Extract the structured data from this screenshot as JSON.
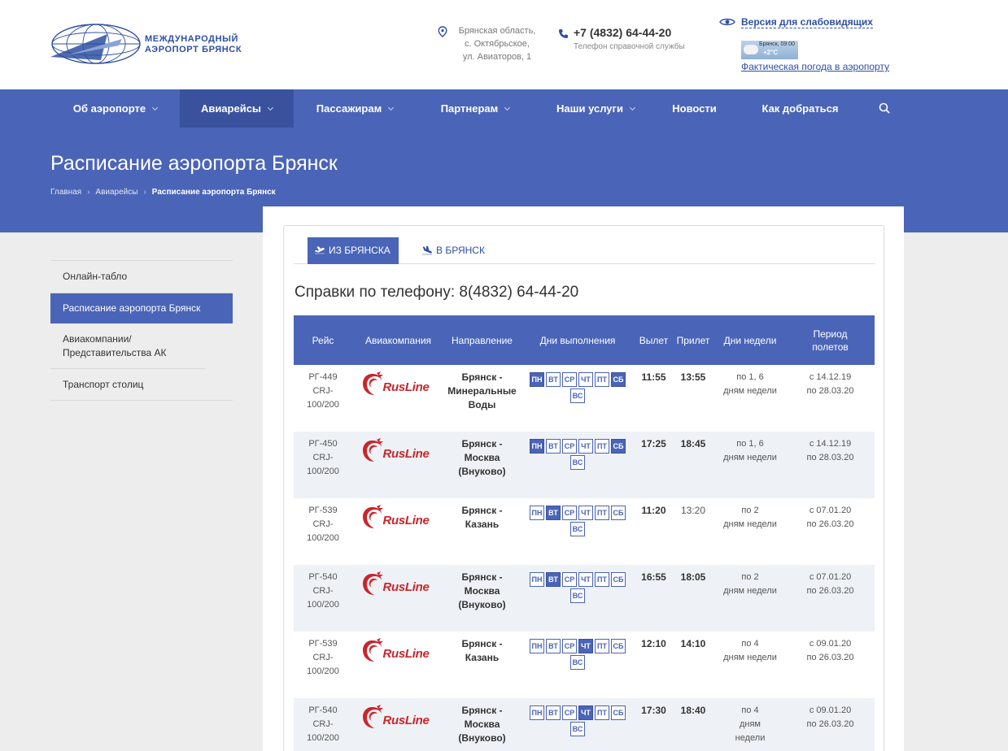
{
  "header": {
    "logo_line1": "МЕЖДУНАРОДНЫЙ",
    "logo_line2": "АЭРОПОРТ БРЯНСК",
    "address_lines": [
      "Брянская область,",
      "с. Октябрьское,",
      "ул. Авиаторов, 1"
    ],
    "phone": "+7 (4832) 64-44-20",
    "phone_label": "Телефон справочной службы",
    "vision_link": "Версия для слабовидящих",
    "weather_place": "Брянск, 09:00",
    "weather_temp": "+2°C",
    "weather_link": "Фактическая погода в аэропорту"
  },
  "nav": {
    "items": [
      {
        "label": "Об аэропорте",
        "dropdown": true
      },
      {
        "label": "Авиарейсы",
        "dropdown": true,
        "active": true
      },
      {
        "label": "Пассажирам",
        "dropdown": true
      },
      {
        "label": "Партнерам",
        "dropdown": true
      },
      {
        "label": "Наши услуги",
        "dropdown": true
      },
      {
        "label": "Новости",
        "dropdown": false
      },
      {
        "label": "Как добраться",
        "dropdown": false
      }
    ],
    "search_icon": "search-icon"
  },
  "banner": {
    "title": "Расписание аэропорта Брянск",
    "breadcrumb": [
      "Главная",
      "Авиарейсы",
      "Расписание аэропорта Брянск"
    ]
  },
  "sidebar": {
    "items": [
      {
        "label": "Онлайн-табло"
      },
      {
        "label": "Расписание аэропорта Брянск",
        "active": true
      },
      {
        "label": "Авиакомпании/ Представительства АК"
      },
      {
        "label": "Транспорт столиц"
      }
    ]
  },
  "tabs": {
    "from": "ИЗ БРЯНСКА",
    "to": "В БРЯНСК"
  },
  "phone_heading": "Справки по телефону: 8(4832) 64-44-20",
  "table": {
    "headers": {
      "flight": "Рейс",
      "airline": "Авиакомпания",
      "direction": "Направление",
      "days": "Дни выполнения",
      "departure": "Вылет",
      "arrival": "Прилет",
      "weekdays": "Дни недели",
      "period_line1": "Период",
      "period_line2": "полетов"
    },
    "day_labels": [
      "ПН",
      "ВТ",
      "СР",
      "ЧТ",
      "ПТ",
      "СБ",
      "ВС"
    ],
    "airline_name": "RusLine",
    "rows": [
      {
        "flight": [
          "РГ-449",
          "CRJ-",
          "100/200"
        ],
        "direction": [
          "Брянск -",
          "Минеральные",
          "Воды"
        ],
        "days_on": [
          1,
          6
        ],
        "dep": "11:55",
        "arr": "13:55",
        "arr_light": false,
        "weekdays": [
          "по 1, 6",
          "дням недели"
        ],
        "period": [
          "с 14.12.19",
          "по 28.03.20"
        ]
      },
      {
        "flight": [
          "РГ-450",
          "CRJ-",
          "100/200"
        ],
        "direction": [
          "Брянск -",
          "Москва",
          "(Внуково)"
        ],
        "days_on": [
          1,
          6
        ],
        "dep": "17:25",
        "arr": "18:45",
        "arr_light": false,
        "weekdays": [
          "по 1, 6",
          "дням недели"
        ],
        "period": [
          "с 14.12.19",
          "по 28.03.20"
        ]
      },
      {
        "flight": [
          "РГ-539",
          "CRJ-",
          "100/200"
        ],
        "direction": [
          "Брянск -",
          "Казань"
        ],
        "days_on": [
          2
        ],
        "dep": "11:20",
        "arr": "13:20",
        "arr_light": true,
        "weekdays": [
          "по 2",
          "дням недели"
        ],
        "period": [
          "с 07.01.20",
          "по 26.03.20"
        ]
      },
      {
        "flight": [
          "РГ-540",
          "CRJ-",
          "100/200"
        ],
        "direction": [
          "Брянск -",
          "Москва",
          "(Внуково)"
        ],
        "days_on": [
          2
        ],
        "dep": "16:55",
        "arr": "18:05",
        "arr_light": false,
        "weekdays": [
          "по 2",
          "дням недели"
        ],
        "period": [
          "с 07.01.20",
          "по 26.03.20"
        ]
      },
      {
        "flight": [
          "РГ-539",
          "CRJ-",
          "100/200"
        ],
        "direction": [
          "Брянск -",
          "Казань"
        ],
        "days_on": [
          4
        ],
        "dep": "12:10",
        "arr": "14:10",
        "arr_light": false,
        "weekdays": [
          "по 4",
          "дням недели"
        ],
        "period": [
          "с 09.01.20",
          "по 26.03.20"
        ]
      },
      {
        "flight": [
          "РГ-540",
          "CRJ-",
          "100/200"
        ],
        "direction": [
          "Брянск -",
          "Москва",
          "(Внуково)"
        ],
        "days_on": [
          4
        ],
        "dep": "17:30",
        "arr": "18:40",
        "arr_light": false,
        "weekdays": [
          "по 4",
          "дням",
          "недели"
        ],
        "period": [
          "с 09.01.20",
          "по 26.03.20"
        ]
      }
    ]
  },
  "colors": {
    "brand_blue": "#4a64b7",
    "brand_blue_dark": "#3a529e",
    "rusline_red": "#c9262c",
    "row_alt": "#eef2f6"
  }
}
